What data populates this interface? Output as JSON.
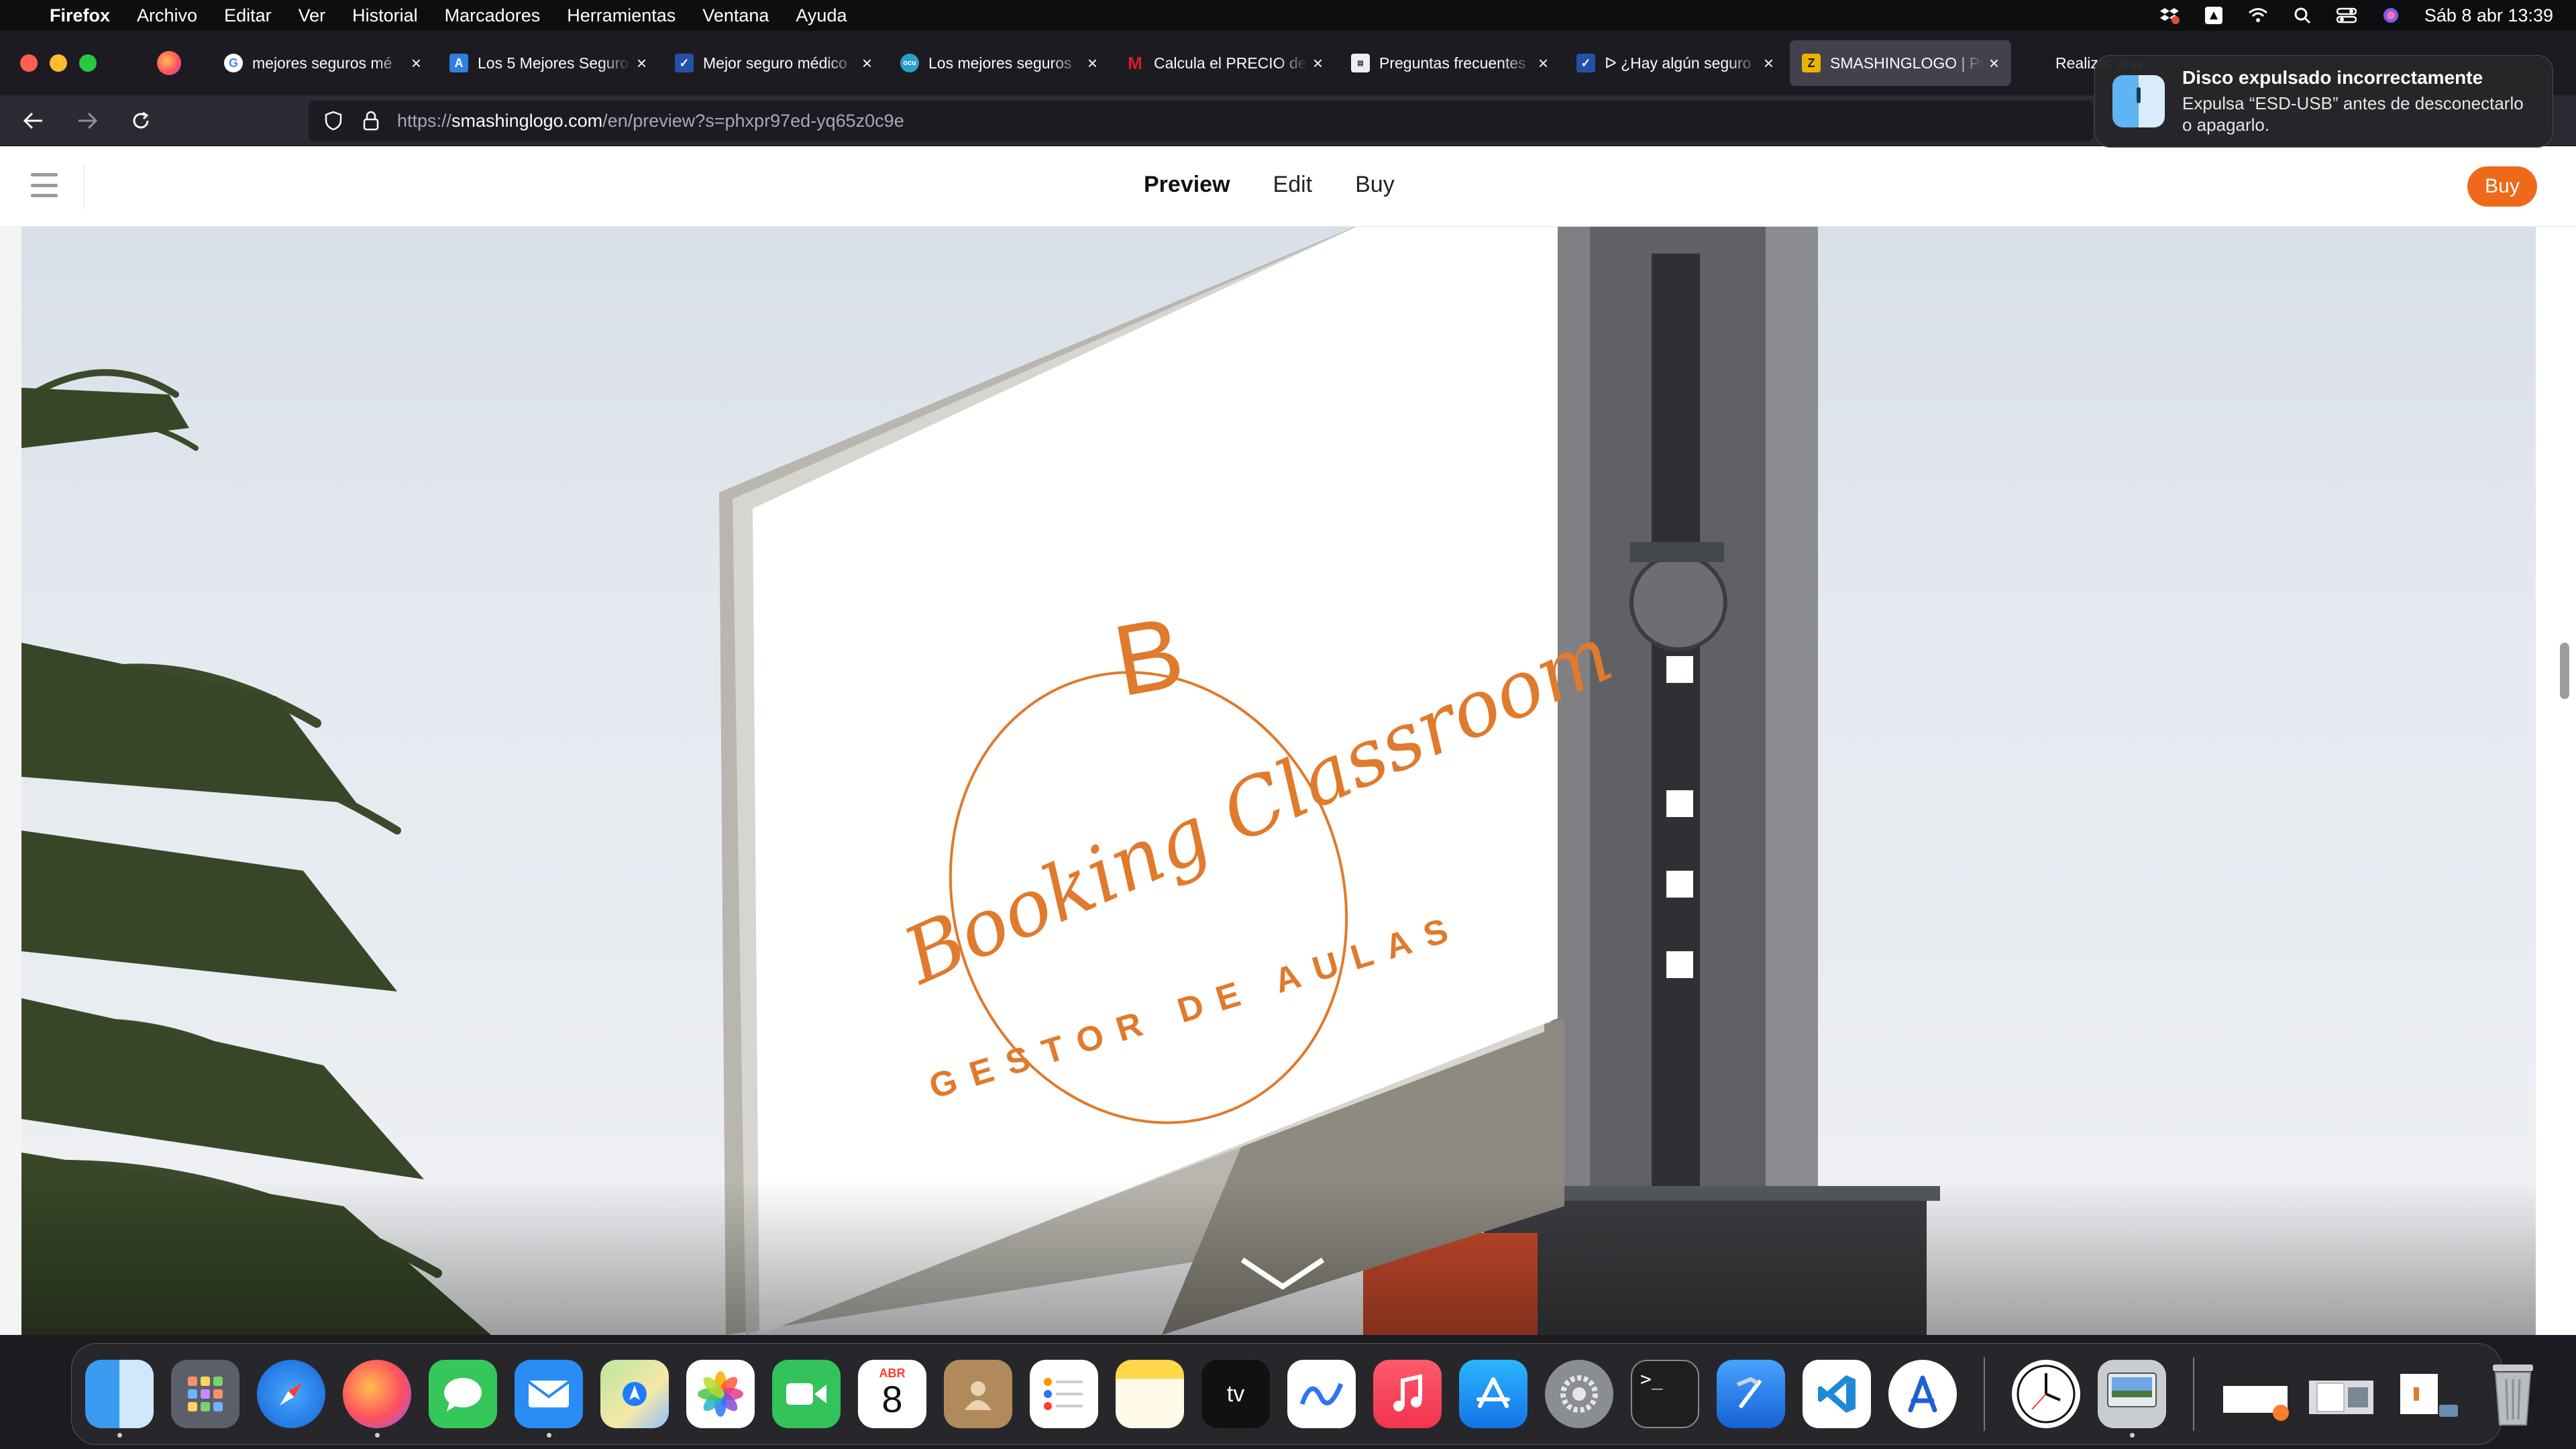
{
  "menubar": {
    "app_name": "Firefox",
    "menus": [
      "Archivo",
      "Editar",
      "Ver",
      "Historial",
      "Marcadores",
      "Herramientas",
      "Ventana",
      "Ayuda"
    ],
    "clock": "Sáb 8 abr 13:39"
  },
  "tabs": [
    {
      "title": "mejores seguros mé",
      "icon": "google-icon",
      "color": "#ffffff"
    },
    {
      "title": "Los 5 Mejores Seguros",
      "icon": "a-icon",
      "color": "#2f7fe0"
    },
    {
      "title": "Mejor seguro médico",
      "icon": "check-icon",
      "color": "#2451a6"
    },
    {
      "title": "Los mejores seguros",
      "icon": "ocu-icon",
      "color": "#2aa0c8"
    },
    {
      "title": "Calcula el PRECIO de",
      "icon": "m-icon",
      "color": "#d21f2a"
    },
    {
      "title": "Preguntas frecuentes",
      "icon": "doc-icon",
      "color": "#eeeeee"
    },
    {
      "title": "ᐅ ¿Hay algún seguro",
      "icon": "check-icon",
      "color": "#2451a6"
    },
    {
      "title": "SMASHINGLOGO | Pr",
      "icon": "s-icon",
      "color": "#e8b400"
    },
    {
      "title": "Realizar una",
      "icon": "apple-icon",
      "color": "#9a9a9a"
    }
  ],
  "url": {
    "prefix": "https://",
    "host": "smashinglogo.com",
    "path": "/en/preview?s=phxpr97ed-yq65z0c9e"
  },
  "site": {
    "nav": [
      "Preview",
      "Edit",
      "Buy"
    ],
    "buy_button": "Buy"
  },
  "logo": {
    "monogram": "B",
    "script_text": "Booking Classroom",
    "tagline": "GESTOR DE AULAS",
    "color": "#e07a2c"
  },
  "notification": {
    "title": "Disco expulsado incorrectamente",
    "body": "Expulsa “ESD-USB” antes de desconectarlo o apagarlo."
  },
  "dock": {
    "calendar_month": "ABR",
    "calendar_day": "8",
    "apps": [
      "finder-icon",
      "launchpad-icon",
      "safari-icon",
      "firefox-icon",
      "messages-icon",
      "mail-icon",
      "maps-icon",
      "photos-icon",
      "facetime-icon",
      "calendar-icon",
      "contacts-icon",
      "reminders-icon",
      "notes-icon",
      "appletv-icon",
      "freeform-icon",
      "music-icon",
      "appstore-icon",
      "settings-icon",
      "terminal-icon",
      "xcode-icon",
      "vscode-icon",
      "instruments-icon"
    ]
  }
}
